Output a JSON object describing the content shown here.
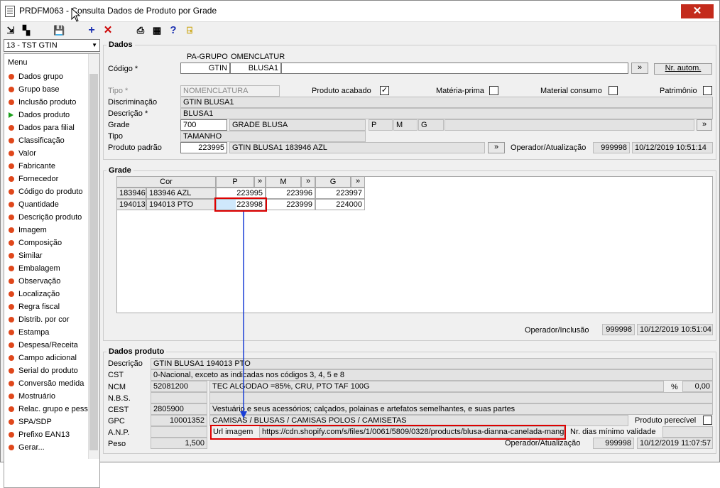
{
  "window": {
    "title": "PRDFM063 - Consulta Dados de Produto por Grade",
    "close_label": "✕"
  },
  "company_select": "13 - TST GTIN",
  "menu": {
    "header": "Menu",
    "items": [
      "Dados grupo",
      "Grupo base",
      "Inclusão produto",
      "Dados produto",
      "Dados para filial",
      "Classificação",
      "Valor",
      "Fabricante",
      "Fornecedor",
      "Código do produto",
      "Quantidade",
      "Descrição produto",
      "Imagem",
      "Composição",
      "Similar",
      "Embalagem",
      "Observação",
      "Localização",
      "Regra fiscal",
      "Distrib. por cor",
      "Estampa",
      "Despesa/Receita",
      "Campo adicional",
      "Serial do produto",
      "Conversão medida",
      "Mostruário",
      "Relac. grupo e pess",
      "SPA/SDP",
      "Prefixo EAN13",
      "Gerar..."
    ],
    "active": "Dados produto"
  },
  "dados": {
    "legend": "Dados",
    "codigo_label": "Código *",
    "col1_header": "PA-GRUPO",
    "col2_header": "OMENCLATUR",
    "col1_value": "GTIN",
    "col2_value": "BLUSA1",
    "nr_autom": "Nr. autom.",
    "tipo_label": "Tipo *",
    "tipo_value": "NOMENCLATURA",
    "produto_acabado": "Produto acabado",
    "materia_prima": "Matéria-prima",
    "material_consumo": "Material consumo",
    "patrimonio": "Patrimônio",
    "discriminacao_label": "Discriminação",
    "discriminacao_value": "GTIN BLUSA1",
    "descricao_label": "Descrição *",
    "descricao_value": "BLUSA1",
    "grade_label": "Grade",
    "grade_code": "700",
    "grade_name": "GRADE BLUSA",
    "grade_sizes": [
      "P",
      "M",
      "G"
    ],
    "tipo2_label": "Tipo",
    "tipo2_value": "TAMANHO",
    "produto_padrao_label": "Produto padrão",
    "produto_padrao_code": "223995",
    "produto_padrao_desc": "GTIN BLUSA1 183946 AZL",
    "operador_label": "Operador/Atualização",
    "operador_code": "999998",
    "operador_date": "10/12/2019 10:51:14"
  },
  "grade": {
    "legend": "Grade",
    "headers": [
      "Cor",
      "P",
      "M",
      "G"
    ],
    "rows": [
      {
        "code": "183946",
        "name": "183946 AZL",
        "p": "223995",
        "m": "223996",
        "g": "223997"
      },
      {
        "code": "194013",
        "name": "194013 PTO",
        "p": "223998",
        "m": "223999",
        "g": "224000"
      }
    ],
    "operador_label": "Operador/Inclusão",
    "operador_code": "999998",
    "operador_date": "10/12/2019 10:51:04"
  },
  "dados_produto": {
    "legend": "Dados produto",
    "descricao_label": "Descrição",
    "descricao_value": "GTIN BLUSA1 194013 PTO",
    "cst_label": "CST",
    "cst_value": "0-Nacional, exceto as indicadas nos códigos 3, 4, 5 e 8",
    "ncm_label": "NCM",
    "ncm_code": "52081200",
    "ncm_desc": "TEC ALGODAO  =85%, CRU, PTO TAF 100G",
    "pct_label": "%",
    "pct_value": "0,00",
    "nbs_label": "N.B.S.",
    "cest_label": "CEST",
    "cest_code": "2805900",
    "cest_desc": "Vestuário e seus acessórios; calçados, polainas e artefatos semelhantes, e suas partes",
    "gpc_label": "GPC",
    "gpc_code": "10001352",
    "gpc_desc": "CAMISAS / BLUSAS / CAMISAS POLOS / CAMISETAS",
    "perecivel_label": "Produto perecível",
    "anp_label": "A.N.P.",
    "url_label": "Url imagem",
    "url_value": "https://cdn.shopify.com/s/files/1/0061/5809/0328/products/blusa-dianna-canelada-mang",
    "validade_label": "Nr. dias mínimo validade",
    "peso_label": "Peso",
    "peso_value": "1,500",
    "operador_label": "Operador/Atualização",
    "operador_code": "999998",
    "operador_date": "10/12/2019 11:07:57"
  },
  "colors": {
    "highlight": "#d00000",
    "arrow": "#1a3fd6",
    "cell_select": "#cfe8fc"
  }
}
